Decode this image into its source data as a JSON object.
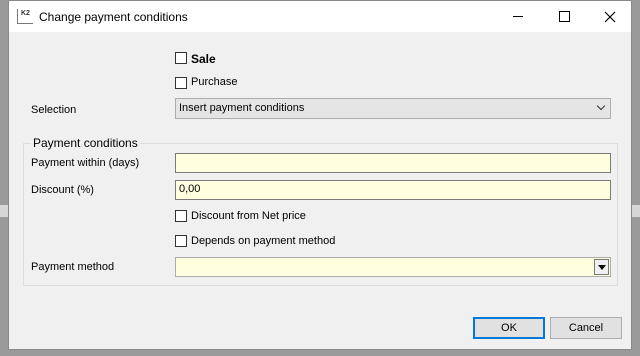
{
  "window": {
    "title": "Change payment conditions",
    "icon_text": "K2"
  },
  "type": {
    "sale_label": "Sale",
    "purchase_label": "Purchase"
  },
  "selection": {
    "label": "Selection",
    "value": "Insert payment conditions"
  },
  "payment_conditions": {
    "group_title": "Payment conditions",
    "payment_within_label": "Payment within (days)",
    "payment_within_value": "",
    "discount_label": "Discount (%)",
    "discount_value": "0,00",
    "discount_net_label": "Discount from Net price",
    "depends_method_label": "Depends on payment method",
    "payment_method_label": "Payment method",
    "payment_method_value": ""
  },
  "buttons": {
    "ok": "OK",
    "cancel": "Cancel"
  }
}
